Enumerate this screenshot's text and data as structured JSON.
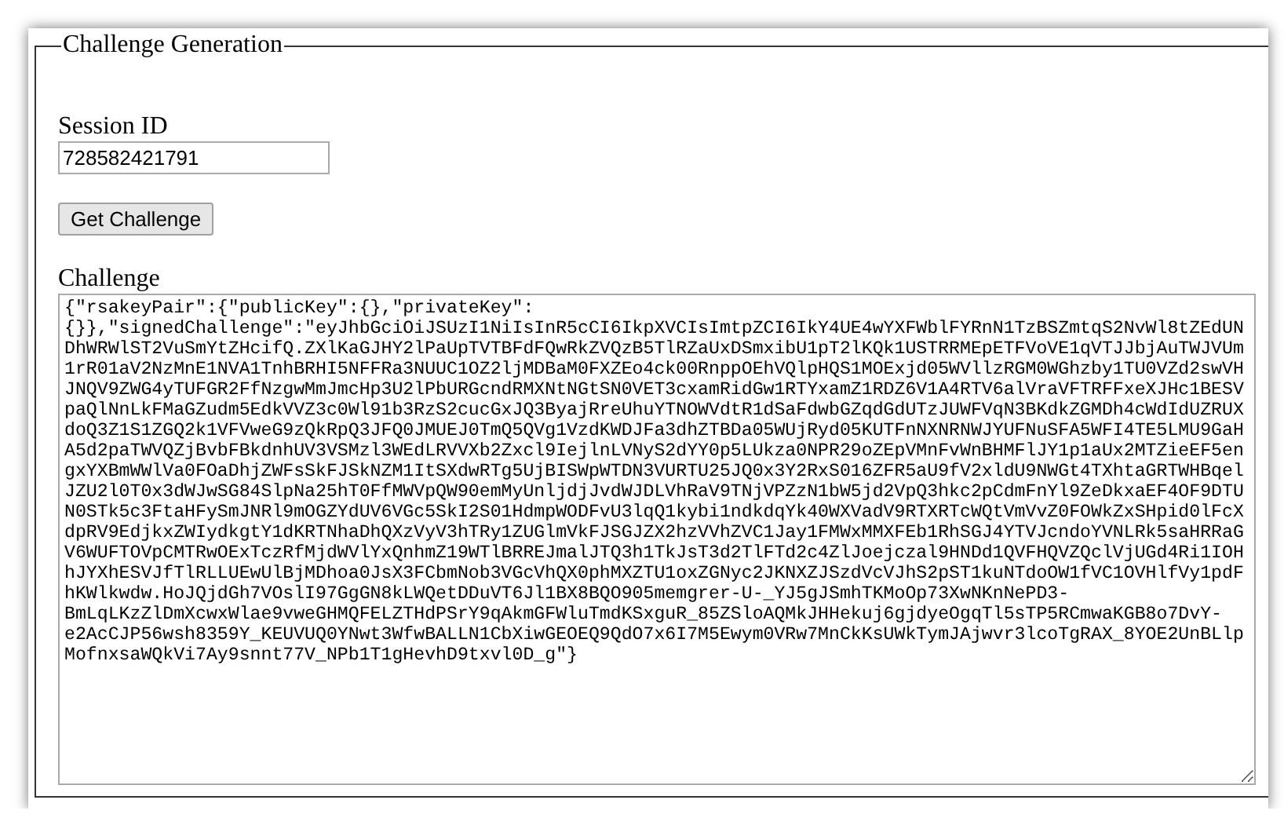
{
  "fieldset": {
    "legend": "Challenge Generation"
  },
  "session": {
    "label": "Session ID",
    "value": "728582421791"
  },
  "button": {
    "label": "Get Challenge"
  },
  "challenge": {
    "label": "Challenge",
    "value": "{\"rsakeyPair\":{\"publicKey\":{},\"privateKey\":{}},\"signedChallenge\":\"eyJhbGciOiJSUzI1NiIsInR5cCI6IkpXVCIsImtpZCI6IkY4UE4wYXFWblFYRnN1TzBSZmtqS2NvWl8tZEdUNDhWRWlST2VuSmYtZHcifQ.ZXlKaGJHY2lPaUpTVTBFdFQwRkZVQzB5TlRZaUxDSmxibU1pT2lKQk1USTRRMEpETFVoVE1qVTJJbjAuTWJVUm1rR01aV2NzMnE1NVA1TnhBRHI5NFFRa3NUUC1OZ2ljMDBaM0FXZEo4ck00RnppOEhVQlpHQS1MOExjd05WVllzRGM0WGhzby1TU0VZd2swVHJNQV9ZWG4yTUFGR2FfNzgwMmJmcHp3U2lPbURGcndRMXNtNGtSN0VET3cxamRidGw1RTYxamZ1RDZ6V1A4RTV6alVraVFTRFFxeXJHc1BESVpaQlNnLkFMaGZudm5EdkVVZ3c0Wl91b3RzS2cucGxJQ3ByajRreUhuYTNOWVdtR1dSaFdwbGZqdGdUTzJUWFVqN3BKdkZGMDh4cWdIdUZRUXdoQ3Z1S1ZGQ2k1VFVweG9zQkRpQ3JFQ0JMUEJ0TmQ5QVg1VzdKWDJFa3dhZTBDa05WUjRyd05KUTFnNXNRNWJYUFNuSFA5WFI4TE5LMU9GaHA5d2paTWVQZjBvbFBkdnhUV3VSMzl3WEdLRVVXb2Zxcl9IejlnLVNyS2dYY0p5LUkza0NPR29oZEpVMnFvWnBHMFlJY1p1aUx2MTZieEF5engxYXBmWWlVa0FOaDhjZWFsSkFJSkNZM1ItSXdwRTg5UjBISWpWTDN3VURTU25JQ0x3Y2RxS016ZFR5aU9fV2xldU9NWGt4TXhtaGRTWHBqelJZU2l0T0x3dWJwSG84SlpNa25hT0FfMWVpQW90emMyUnljdjJvdWJDLVhRaV9TNjVPZzN1bW5jd2VpQ3hkc2pCdmFnYl9ZeDkxaEF4OF9DTUN0STk5c3FtaHFySmJNRl9mOGZYdUV6VGc5SkI2S01HdmpWODFvU3lqQ1kybi1ndkdqYk40WXVadV9RTXRTcWQtVmVvZ0FOWkZxSHpid0lFcXdpRV9EdjkxZWIydkgtY1dKRTNhaDhQXzVyV3hTRy1ZUGlmVkFJSGJZX2hzVVhZVC1Jay1FMWxMMXFEb1RhSGJ4YTVJcndoYVNLRk5saHRRaGV6WUFTOVpCMTRwOExTczRfMjdWVlYxQnhmZ19WTlBRREJmalJTQ3h1TkJsT3d2TlFTd2c4ZlJoejczal9HNDd1QVFHQVZQclVjUGd4Ri1IOHhJYXhESVJfTlRLLUEwUlBjMDhoa0JsX3FCbmNob3VGcVhQX0phMXZTU1oxZGNyc2JKNXZJSzdVcVJhS2pST1kuNTdoOW1fVC1OVHlfVy1pdFhKWlkwdw.HoJQjdGh7VOslI97GgGN8kLWQetDDuVT6Jl1BX8BQO905memgrer-U-_YJ5gJSmhTKMoOp73XwNKnNePD3-BmLqLKzZlDmXcwxWlae9vweGHMQFELZTHdPSrY9qAkmGFWluTmdKSxguR_85ZSloAQMkJHHekuj6gjdyeOgqTl5sTP5RCmwaKGB8o7DvY-e2AcCJP56wsh8359Y_KEUVUQ0YNwt3WfwBALLN1CbXiwGEOEQ9QdO7x6I7M5Ewym0VRw7MnCkKsUWkTymJAjwvr3lcoTgRAX_8YOE2UnBLlpMofnxsaWQkVi7Ay9snnt77V_NPb1T1gHevhD9txvl0D_g\"}"
  }
}
